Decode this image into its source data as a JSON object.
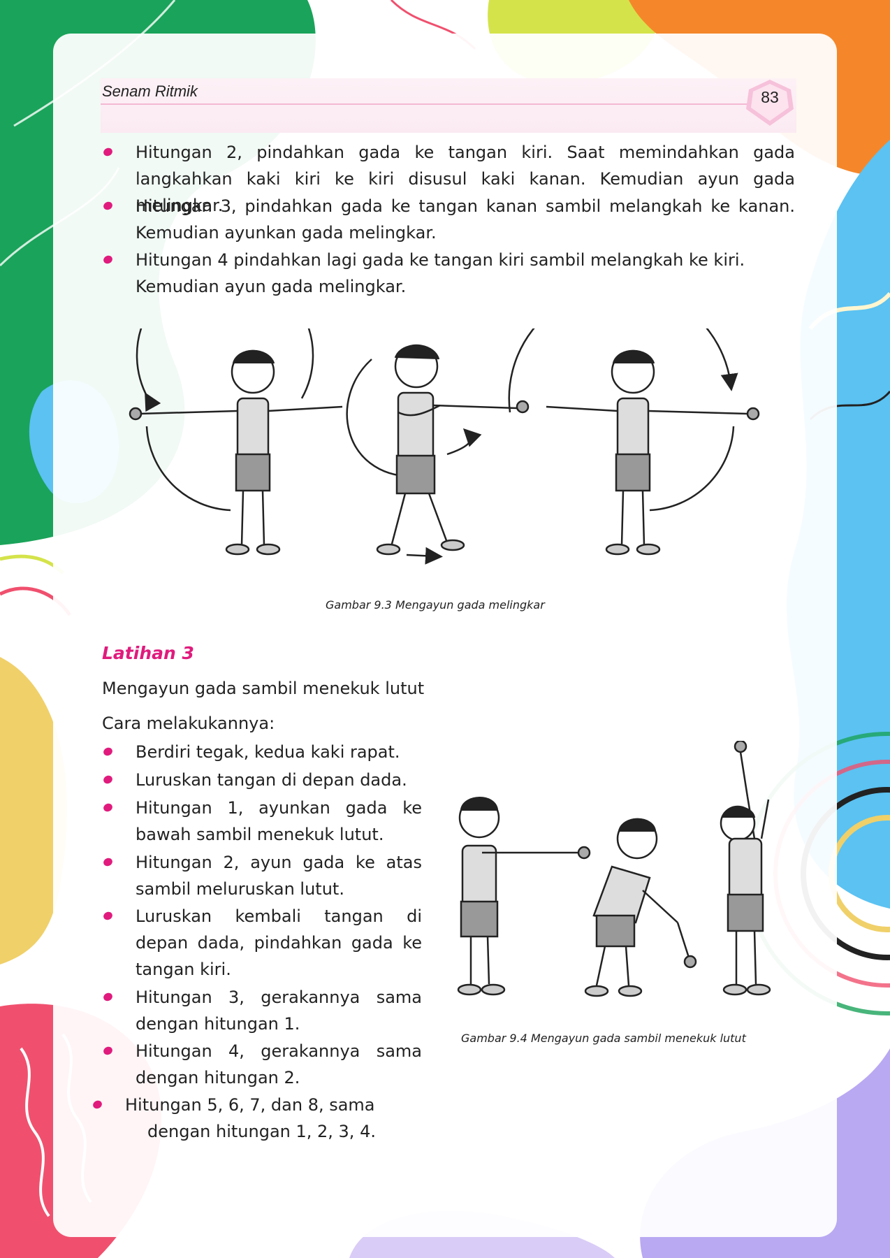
{
  "header": {
    "title": "Senam Ritmik",
    "page_number": "83"
  },
  "intro_bullets": [
    {
      "text": "Hitungan 2, pindahkan gada ke tangan kiri. Saat memindahkan gada langkahkan kaki kiri ke kiri disusul kaki kanan. Kemudian ayun gada melingkar."
    },
    {
      "text": "Hitungan 3, pindahkan gada ke tangan kanan sambil melangkah ke kanan. Kemudian ayunkan gada melingkar."
    },
    {
      "line1": "Hitungan 4 pindahkan lagi gada ke tangan kiri sambil melangkah ke kiri.",
      "line2": "Kemudian ayun gada melingkar."
    }
  ],
  "figure_1": {
    "caption": "Gambar 9.3 Mengayun gada melingkar"
  },
  "section": {
    "title": "Latihan 3",
    "subtitle": "Mengayun gada sambil menekuk lutut",
    "method_label": "Cara melakukannya:",
    "steps": [
      "Berdiri tegak, kedua kaki rapat.",
      "Luruskan tangan di depan dada.",
      "Hitungan 1, ayunkan gada ke bawah sambil menekuk lutut.",
      "Hitungan 2, ayun gada ke atas sambil meluruskan lutut.",
      "Luruskan kembali tangan di depan dada, pindahkan gada ke tangan kiri.",
      "Hitungan 3, gerakannya sama dengan hitungan 1.",
      "Hitungan 4, gerakannya sama dengan hitungan 2."
    ],
    "last_step": {
      "line1": "Hitungan 5, 6, 7, dan 8, sama",
      "line2": "dengan hitungan 1, 2, 3, 4."
    }
  },
  "figure_2": {
    "caption": "Gambar 9.4 Mengayun gada sambil menekuk lutut"
  },
  "colors": {
    "accent": "#e01b7d",
    "green": "#1aa35a",
    "orange": "#f5872a",
    "blue": "#5bc2f2",
    "lime": "#d4e34a",
    "red": "#f0506e",
    "yellow": "#f0d069",
    "purple": "#b9a8f2"
  }
}
